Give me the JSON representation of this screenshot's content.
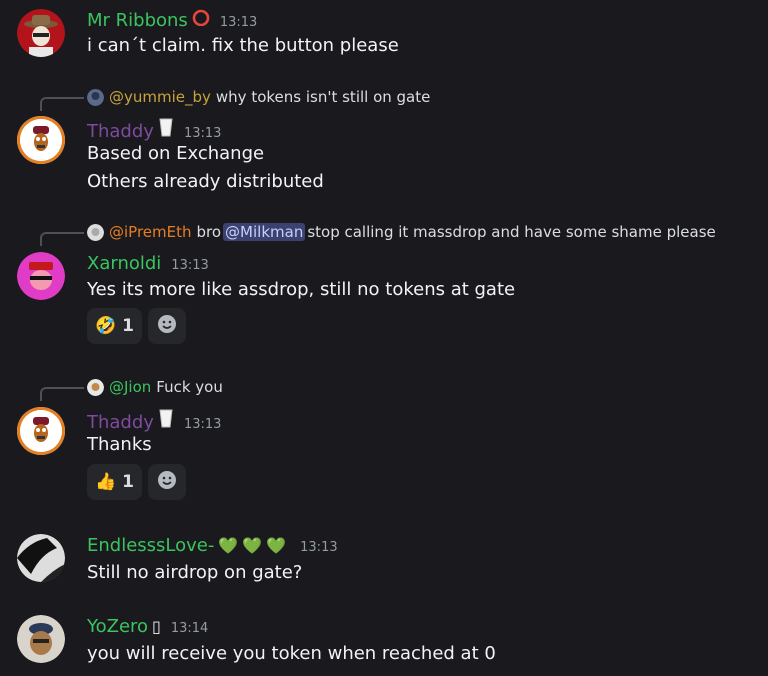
{
  "colors": {
    "green_name": "#3ac45f",
    "purple_name": "#7e4b9e",
    "reply_green": "#3ac45f",
    "reply_gold": "#c7a33a",
    "reply_orange": "#e67e22"
  },
  "messages": [
    {
      "author": "Mr Ribbons",
      "badge": "red-circle-icon",
      "time": "13:13",
      "lines": [
        "i can´t claim. fix the button please"
      ]
    },
    {
      "reply": {
        "name": "@yummie_by",
        "text": "why tokens isn't still on gate"
      },
      "author": "Thaddy",
      "badge": "milk-glass-icon",
      "time": "13:13",
      "lines": [
        "Based on Exchange",
        "Others already distributed"
      ]
    },
    {
      "reply": {
        "name": "@iPremEth",
        "text_before": "bro",
        "mention": "@Milkman",
        "text_after": "stop calling it massdrop and have some shame please"
      },
      "author": "Xarnoldi",
      "time": "13:13",
      "lines": [
        "Yes its more like assdrop, still no tokens at gate"
      ],
      "reactions": [
        {
          "emoji": "🤣",
          "count": "1"
        }
      ]
    },
    {
      "reply": {
        "name": "@Jion",
        "text": "Fuck you"
      },
      "author": "Thaddy",
      "badge": "milk-glass-icon",
      "time": "13:13",
      "lines": [
        "Thanks"
      ],
      "reactions": [
        {
          "emoji": "👍",
          "count": "1"
        }
      ]
    },
    {
      "author": "EndlesssLove-",
      "badge_text": "💚💚💚",
      "time": "13:13",
      "lines": [
        "Still no airdrop on gate?"
      ]
    },
    {
      "author": "YoZero",
      "badge_text": "▯",
      "time": "13:14",
      "lines": [
        "you will receive you token when reached at 0"
      ]
    }
  ]
}
